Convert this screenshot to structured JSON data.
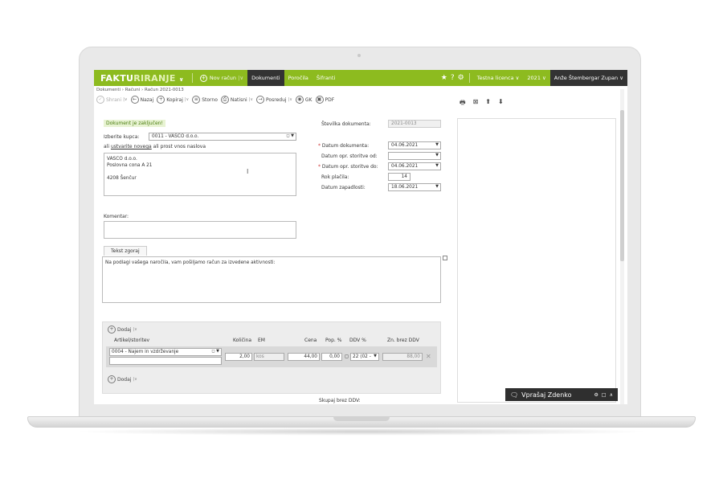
{
  "nav": {
    "brand_a": "FAKTU",
    "brand_b": "RIRANJE",
    "new_invoice": "Nov račun",
    "tabs": [
      "Dokumenti",
      "Poročila",
      "Šifranti"
    ],
    "license": "Testna licenca",
    "year": "2021",
    "user": "Anže Štembergar Zupan"
  },
  "breadcrumb": "Dokumenti › Računi › Račun 2021-0013",
  "toolbar": {
    "save": "Shrani",
    "back": "Nazaj",
    "copy": "Kopiraj",
    "cancel": "Storno",
    "print": "Natisni",
    "forward": "Posreduj",
    "gk": "GK",
    "pdf": "PDF"
  },
  "form": {
    "locked_msg": "Dokument je zaključen!",
    "buyer_label": "Izberite kupca:",
    "buyer_value": "0011 - VASCO d.o.o.",
    "buyer_alt_a": "ali",
    "buyer_alt_link": "ustvarite novega",
    "buyer_alt_b": "ali prost vnos naslova",
    "address_lines": [
      "VASCO d.o.o.",
      "Poslovna cona A 21",
      "",
      "4208 Šenčur"
    ],
    "comment_label": "Komentar:",
    "doc_no_label": "Številka dokumenta:",
    "doc_no_value": "2021-0013",
    "doc_date_label": "Datum dokumenta:",
    "doc_date_value": "04.06.2021",
    "svc_from_label": "Datum opr. storitve od:",
    "svc_from_value": "",
    "svc_to_label": "Datum opr. storitve do:",
    "svc_to_value": "04.06.2021",
    "due_label": "Rok plačila:",
    "due_value": "14",
    "due_date_label": "Datum zapadlosti:",
    "due_date_value": "18.06.2021",
    "text_tab": "Tekst zgoraj",
    "text_body": "Na podlagi vašega naročila, vam pošiljamo račun za izvedene aktivnosti:"
  },
  "items": {
    "add": "Dodaj",
    "headers": [
      "Artikel/storitev",
      "Količina",
      "EM",
      "Cena",
      "Pop. %",
      "DDV %",
      "Zn. brez DDV"
    ],
    "row": {
      "article": "0004 - Najem in vzdrževanje",
      "qty": "2,00",
      "unit": "kos",
      "price": "44,00",
      "discount": "0,00",
      "vat": "22 (02 -",
      "net": "88,00"
    },
    "sum_label": "Skupaj brez DDV:"
  },
  "chat": {
    "label": "Vprašaj Zdenko"
  }
}
